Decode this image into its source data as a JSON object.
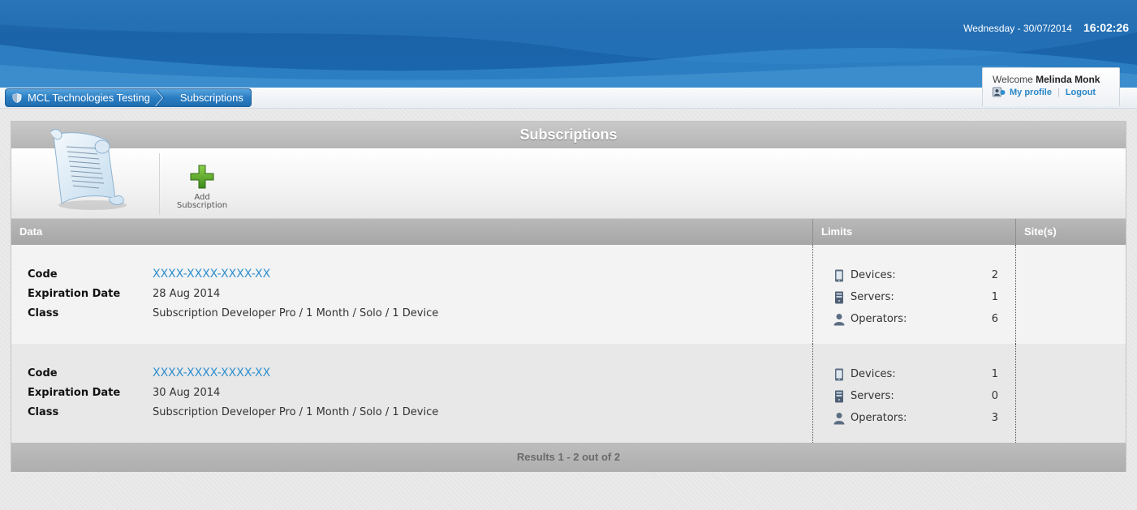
{
  "header": {
    "date": "Wednesday - 30/07/2014",
    "time": "16:02:26"
  },
  "breadcrumb": {
    "items": [
      {
        "label": "MCL Technologies Testing"
      },
      {
        "label": "Subscriptions"
      }
    ]
  },
  "user": {
    "welcome_prefix": "Welcome",
    "name": "Melinda Monk",
    "profile_link": "My profile",
    "logout_link": "Logout"
  },
  "panel": {
    "title": "Subscriptions",
    "add_button": {
      "line1": "Add",
      "line2": "Subscription"
    }
  },
  "table": {
    "headers": {
      "data": "Data",
      "limits": "Limits",
      "sites": "Site(s)"
    },
    "field_labels": {
      "code": "Code",
      "expiration": "Expiration Date",
      "class": "Class"
    },
    "limit_labels": {
      "devices": "Devices:",
      "servers": "Servers:",
      "operators": "Operators:"
    },
    "rows": [
      {
        "code": "XXXX-XXXX-XXXX-XX",
        "expiration": "28 Aug 2014",
        "class": "Subscription Developer Pro / 1 Month / Solo / 1 Device",
        "devices": "2",
        "servers": "1",
        "operators": "6",
        "sites": ""
      },
      {
        "code": "XXXX-XXXX-XXXX-XX",
        "expiration": "30 Aug 2014",
        "class": "Subscription Developer Pro / 1 Month / Solo / 1 Device",
        "devices": "1",
        "servers": "0",
        "operators": "3",
        "sites": ""
      }
    ],
    "footer": "Results 1 - 2 out of 2"
  },
  "colors": {
    "header_blue": "#1b63a8",
    "link_blue": "#2f8fcf",
    "add_green": "#5aa82c"
  },
  "icons": {
    "breadcrumb_root": "shield-icon",
    "profile": "profile-icon",
    "panel_logo": "scroll-document-icon",
    "add": "green-plus-icon",
    "devices": "mobile-device-icon",
    "servers": "server-icon",
    "operators": "person-icon"
  }
}
